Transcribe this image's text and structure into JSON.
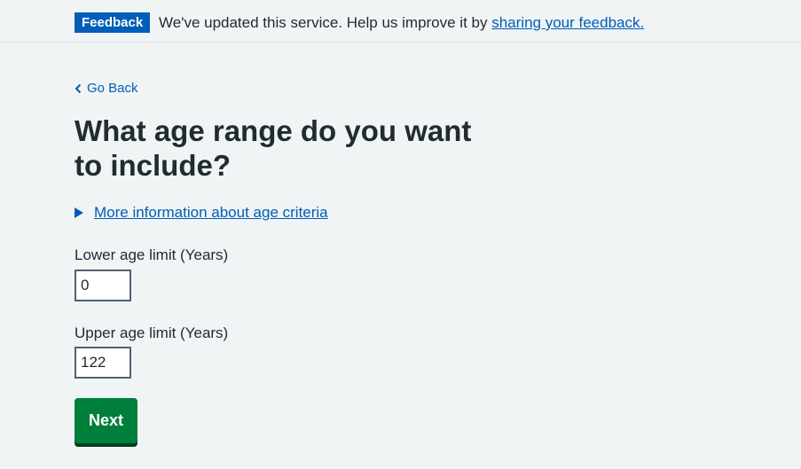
{
  "feedback": {
    "tag": "Feedback",
    "message": "We've updated this service. Help us improve it by ",
    "link_text": "sharing your feedback."
  },
  "back_link": {
    "label": "Go Back"
  },
  "page": {
    "title": "What age range do you want to include?"
  },
  "details": {
    "summary": "More information about age criteria"
  },
  "lower_age": {
    "label": "Lower age limit (Years)",
    "value": "0"
  },
  "upper_age": {
    "label": "Upper age limit (Years)",
    "value": "122"
  },
  "actions": {
    "next_label": "Next"
  },
  "colors": {
    "background": "#f0f4f5",
    "link": "#005eb8",
    "primary_button": "#007f3b",
    "text": "#212b32"
  },
  "icons": {
    "back": "chevron-left-icon",
    "details": "triangle-right-icon"
  }
}
